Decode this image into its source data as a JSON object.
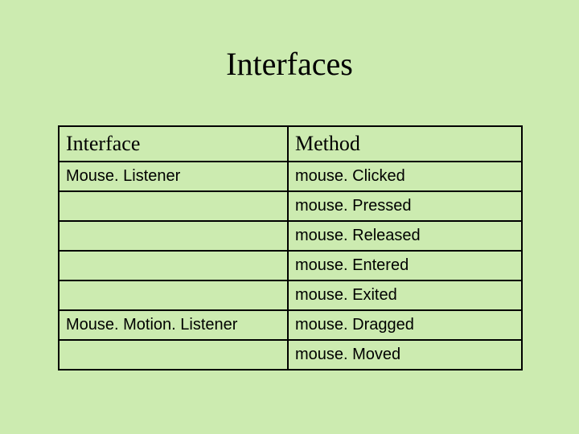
{
  "title": "Interfaces",
  "table": {
    "headers": [
      "Interface",
      "Method"
    ],
    "rows": [
      {
        "iface": "Mouse. Listener",
        "method": "mouse. Clicked"
      },
      {
        "iface": "",
        "method": "mouse. Pressed"
      },
      {
        "iface": "",
        "method": "mouse. Released"
      },
      {
        "iface": "",
        "method": "mouse. Entered"
      },
      {
        "iface": "",
        "method": "mouse. Exited"
      },
      {
        "iface": "Mouse. Motion. Listener",
        "method": "mouse. Dragged"
      },
      {
        "iface": "",
        "method": "mouse. Moved"
      }
    ]
  }
}
